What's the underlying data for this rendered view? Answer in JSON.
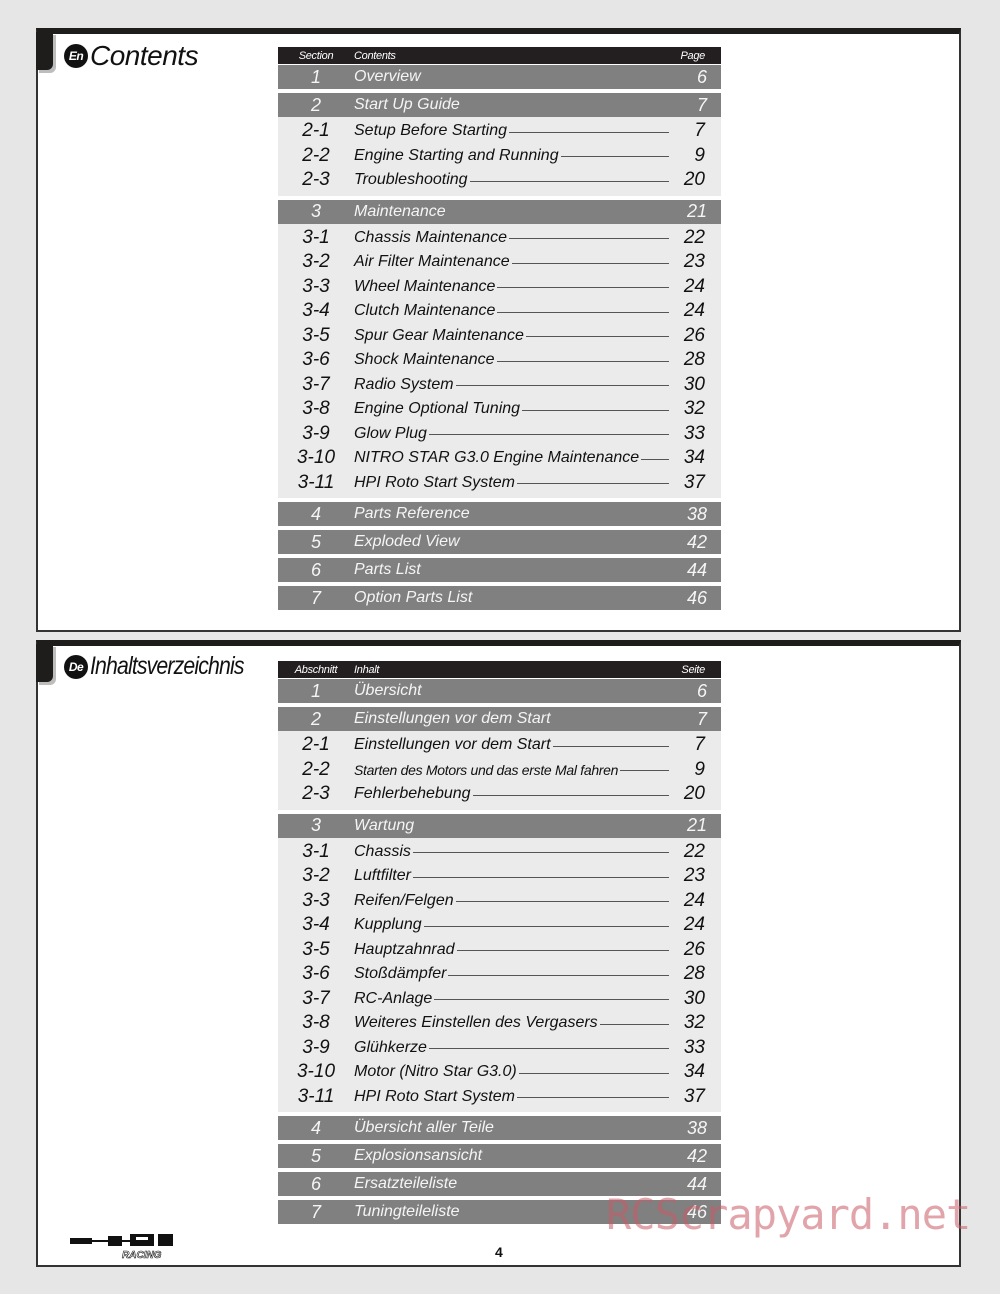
{
  "sections": {
    "en": {
      "lang_badge": "En",
      "title": "Contents",
      "header": {
        "section": "Section",
        "contents": "Contents",
        "page": "Page"
      },
      "groups": [
        {
          "main": {
            "num": "1",
            "title": "Overview",
            "page": "6"
          },
          "subs": []
        },
        {
          "main": {
            "num": "2",
            "title": "Start Up Guide",
            "page": "7"
          },
          "subs": [
            {
              "num": "2-1",
              "title": "Setup Before Starting",
              "page": "7"
            },
            {
              "num": "2-2",
              "title": "Engine Starting and Running",
              "page": "9"
            },
            {
              "num": "2-3",
              "title": "Troubleshooting",
              "page": "20"
            }
          ]
        },
        {
          "main": {
            "num": "3",
            "title": "Maintenance",
            "page": "21"
          },
          "subs": [
            {
              "num": "3-1",
              "title": "Chassis Maintenance",
              "page": "22"
            },
            {
              "num": "3-2",
              "title": "Air Filter Maintenance",
              "page": "23"
            },
            {
              "num": "3-3",
              "title": "Wheel Maintenance",
              "page": "24"
            },
            {
              "num": "3-4",
              "title": "Clutch Maintenance",
              "page": "24"
            },
            {
              "num": "3-5",
              "title": "Spur Gear Maintenance",
              "page": "26"
            },
            {
              "num": "3-6",
              "title": "Shock Maintenance",
              "page": "28"
            },
            {
              "num": "3-7",
              "title": "Radio System",
              "page": "30"
            },
            {
              "num": "3-8",
              "title": "Engine Optional Tuning",
              "page": "32"
            },
            {
              "num": "3-9",
              "title": "Glow Plug",
              "page": "33"
            },
            {
              "num": "3-10",
              "title": "NITRO STAR G3.0 Engine Maintenance",
              "page": "34"
            },
            {
              "num": "3-11",
              "title": "HPI Roto Start System",
              "page": "37"
            }
          ]
        },
        {
          "main": {
            "num": "4",
            "title": "Parts Reference",
            "page": "38"
          },
          "subs": []
        },
        {
          "main": {
            "num": "5",
            "title": "Exploded View",
            "page": "42"
          },
          "subs": []
        },
        {
          "main": {
            "num": "6",
            "title": "Parts List",
            "page": "44"
          },
          "subs": []
        },
        {
          "main": {
            "num": "7",
            "title": "Option Parts List",
            "page": "46"
          },
          "subs": []
        }
      ]
    },
    "de": {
      "lang_badge": "De",
      "title": "Inhaltsverzeichnis",
      "header": {
        "section": "Abschnitt",
        "contents": "Inhalt",
        "page": "Seite"
      },
      "groups": [
        {
          "main": {
            "num": "1",
            "title": "Übersicht",
            "page": "6"
          },
          "subs": []
        },
        {
          "main": {
            "num": "2",
            "title": "Einstellungen vor dem Start",
            "page": "7"
          },
          "subs": [
            {
              "num": "2-1",
              "title": "Einstellungen vor dem Start",
              "page": "7"
            },
            {
              "num": "2-2",
              "title": "Starten des Motors und das erste Mal fahren",
              "page": "9",
              "small": true
            },
            {
              "num": "2-3",
              "title": "Fehlerbehebung",
              "page": "20"
            }
          ]
        },
        {
          "main": {
            "num": "3",
            "title": "Wartung",
            "page": "21"
          },
          "subs": [
            {
              "num": "3-1",
              "title": "Chassis",
              "page": "22"
            },
            {
              "num": "3-2",
              "title": "Luftfilter",
              "page": "23"
            },
            {
              "num": "3-3",
              "title": "Reifen/Felgen",
              "page": "24"
            },
            {
              "num": "3-4",
              "title": "Kupplung",
              "page": "24"
            },
            {
              "num": "3-5",
              "title": "Hauptzahnrad",
              "page": "26"
            },
            {
              "num": "3-6",
              "title": "Stoßdämpfer",
              "page": "28"
            },
            {
              "num": "3-7",
              "title": "RC-Anlage",
              "page": "30"
            },
            {
              "num": "3-8",
              "title": "Weiteres Einstellen des Vergasers",
              "page": "32"
            },
            {
              "num": "3-9",
              "title": "Glühkerze",
              "page": "33"
            },
            {
              "num": "3-10",
              "title": "Motor (Nitro Star G3.0)",
              "page": "34"
            },
            {
              "num": "3-11",
              "title": "HPI Roto Start System",
              "page": "37"
            }
          ]
        },
        {
          "main": {
            "num": "4",
            "title": "Übersicht aller Teile",
            "page": "38"
          },
          "subs": []
        },
        {
          "main": {
            "num": "5",
            "title": "Explosionsansicht",
            "page": "42"
          },
          "subs": []
        },
        {
          "main": {
            "num": "6",
            "title": "Ersatzteileliste",
            "page": "44"
          },
          "subs": []
        },
        {
          "main": {
            "num": "7",
            "title": "Tuningteileliste",
            "page": "46"
          },
          "subs": []
        }
      ]
    }
  },
  "footer": {
    "logo": "HPI Racing logo",
    "logo_sub": "RACING",
    "page_number": "4"
  },
  "watermark": "RCScrapyard.net",
  "colors": {
    "header_bar": "#231f20",
    "main_row": "#808080",
    "sub_block": "#ebebeb",
    "watermark": "#c85a64"
  }
}
